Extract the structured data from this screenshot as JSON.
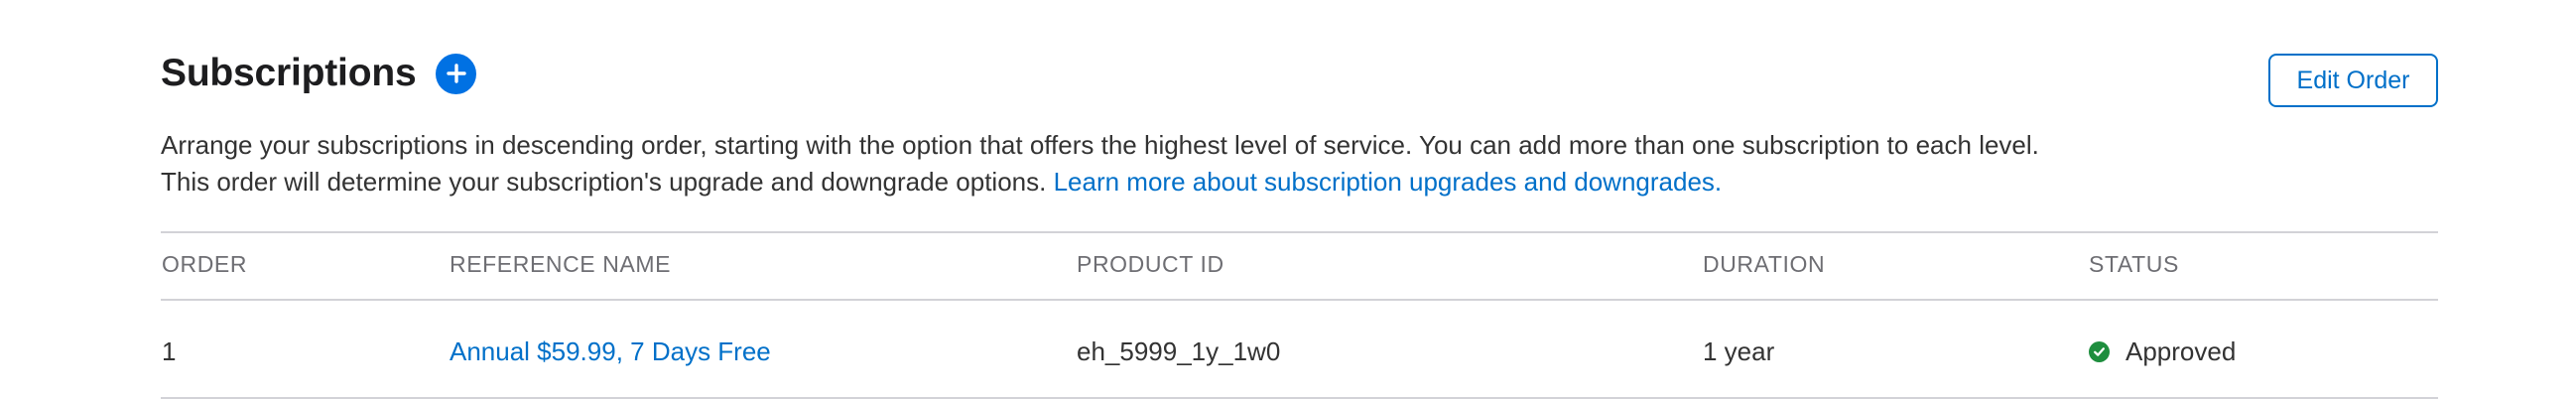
{
  "section": {
    "title": "Subscriptions",
    "edit_button_label": "Edit Order",
    "description_line1": "Arrange your subscriptions in descending order, starting with the option that offers the highest level of service. You can add more than one subscription to each level.",
    "description_line2": "This order will determine your subscription's upgrade and downgrade options.",
    "learn_more_link": "Learn more about subscription upgrades and downgrades."
  },
  "table": {
    "columns": [
      "ORDER",
      "REFERENCE NAME",
      "PRODUCT ID",
      "DURATION",
      "STATUS"
    ],
    "rows": [
      {
        "order": "1",
        "reference_name": "Annual $59.99, 7 Days Free",
        "product_id": "eh_5999_1y_1w0",
        "duration": "1 year",
        "status": "Approved"
      }
    ]
  },
  "icons": {
    "add": "plus-circle-icon",
    "status": "check-circle-icon"
  },
  "colors": {
    "accent": "#0071e3",
    "link": "#0070c9",
    "approved": "#1e8e3e"
  }
}
